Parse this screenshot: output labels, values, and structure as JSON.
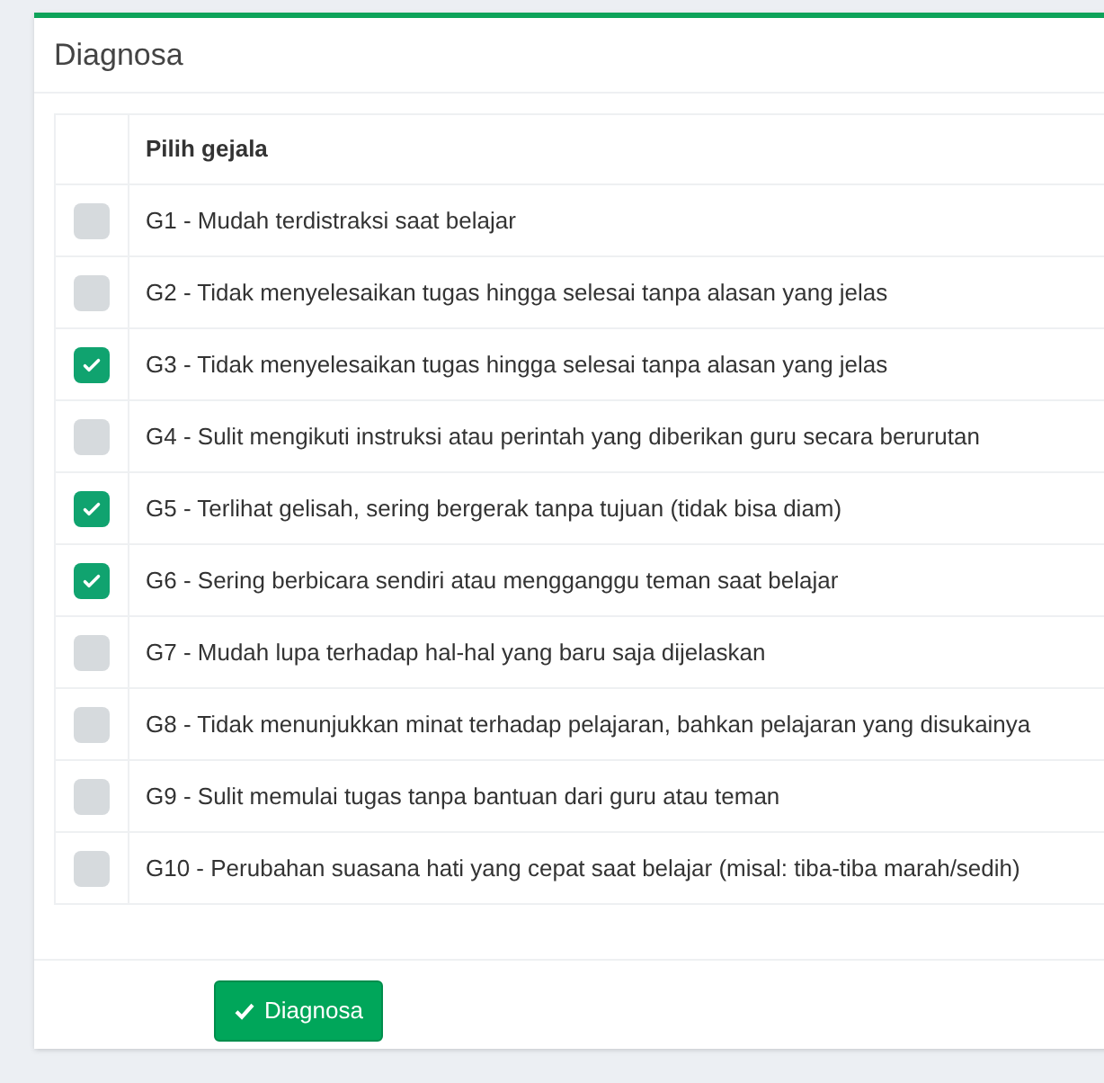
{
  "card": {
    "title": "Diagnosa"
  },
  "table": {
    "column_header": "Pilih gejala",
    "rows": [
      {
        "label": "G1 - Mudah terdistraksi saat belajar",
        "checked": false
      },
      {
        "label": "G2 - Tidak menyelesaikan tugas hingga selesai tanpa alasan yang jelas",
        "checked": false
      },
      {
        "label": "G3 - Tidak menyelesaikan tugas hingga selesai tanpa alasan yang jelas",
        "checked": true
      },
      {
        "label": "G4 - Sulit mengikuti instruksi atau perintah yang diberikan guru secara berurutan",
        "checked": false
      },
      {
        "label": "G5 - Terlihat gelisah, sering bergerak tanpa tujuan (tidak bisa diam)",
        "checked": true
      },
      {
        "label": "G6 - Sering berbicara sendiri atau mengganggu teman saat belajar",
        "checked": true
      },
      {
        "label": "G7 - Mudah lupa terhadap hal-hal yang baru saja dijelaskan",
        "checked": false
      },
      {
        "label": "G8 - Tidak menunjukkan minat terhadap pelajaran, bahkan pelajaran yang disukainya",
        "checked": false
      },
      {
        "label": "G9 - Sulit memulai tugas tanpa bantuan dari guru atau teman",
        "checked": false
      },
      {
        "label": "G10 - Perubahan suasana hati yang cepat saat belajar (misal: tiba-tiba marah/sedih)",
        "checked": false
      }
    ]
  },
  "submit_button": {
    "label": "Diagnosa"
  }
}
